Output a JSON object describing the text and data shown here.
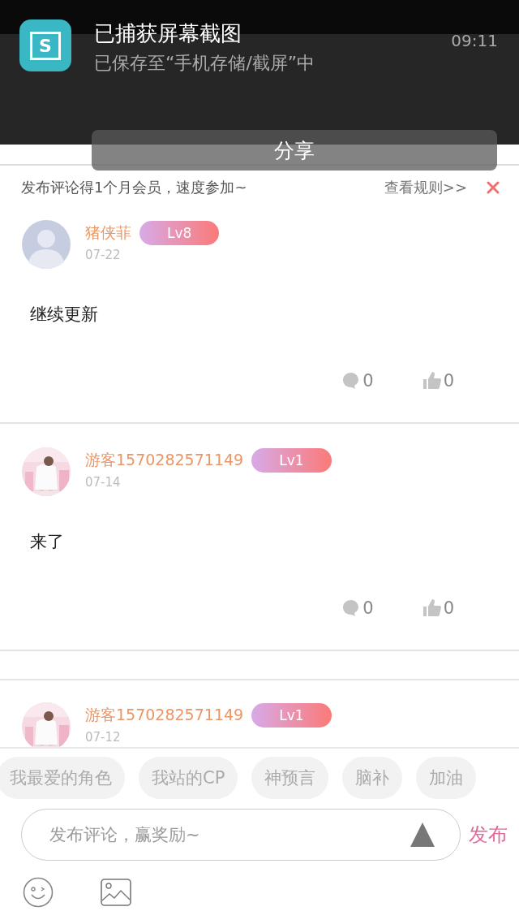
{
  "notification": {
    "icon_label": "S",
    "title": "已捕获屏幕截图",
    "subtitle": "已保存至“手机存储/截屏”中",
    "time": "09:11",
    "action": "分享"
  },
  "banner": {
    "text": "发布评论得1个月会员，速度参加~",
    "link": "查看规则>>"
  },
  "comments": [
    {
      "avatar": {
        "kind": "silhouette"
      },
      "name": "猪侠菲",
      "level": "Lv8",
      "date": "07-22",
      "text": "继续更新",
      "replies": "0",
      "likes": "0"
    },
    {
      "name": "游客1570282571149",
      "level": "Lv1",
      "date": "07-14",
      "text": "来了",
      "replies": "0",
      "likes": "0"
    },
    {
      "name": "游客1570282571149",
      "level": "Lv1",
      "date": "07-12"
    }
  ],
  "chips": [
    "我最爱的角色",
    "我站的CP",
    "神预言",
    "脑补",
    "加油"
  ],
  "composer": {
    "placeholder": "发布评论，赢奖励~",
    "submit": "发布"
  }
}
